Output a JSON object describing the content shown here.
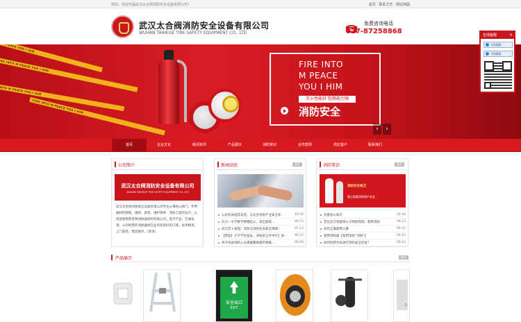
{
  "topbar": {
    "welcome": "您好，欢迎光临武汉太合阀消防安全设备有限公司！",
    "links": [
      "首页",
      "联系方式",
      "网站地图"
    ]
  },
  "header": {
    "company_cn": "武汉太合阀消防安全设备有限公司",
    "company_en": "WUHAN TAIHEGE TIRE SAFETY EQUIPMENT CO., LTD",
    "hotline_label": "免费咨询电话",
    "hotline_number": "027-87258868"
  },
  "banner": {
    "tape_text": "FIRE INTO M PEACE YOU I HIM",
    "promo_lines": [
      "FIRE INTO",
      "M PEACE",
      "YOU I HIM"
    ],
    "tagline": "灭火性能好  阻燃能力强",
    "slogan": "消防安全",
    "prev": "‹",
    "next": "›"
  },
  "nav": {
    "items": [
      "首页",
      "企业文化",
      "新闻资讯",
      "产品展示",
      "消防常识",
      "合作案例",
      "供应客户",
      "联系我们"
    ]
  },
  "about": {
    "title": "公司简介",
    "more": "更多",
    "banner_cn": "武汉太合阀消防安全设备有限公司",
    "banner_en": "WUHAN TAIHEGE TIRE SAFETY EQUIPMENT CO.,LTD",
    "text": "武汉太合阀消防安全设备有限公司专业从事防火阀门、专用器材的销售、维修、安装、维护保养、消防工程的设计，以及配套销售各种消防器材的有限公司。电子产品、交通设施、公司经营的消防器材在业内有良好的口碑，技术精湛，上门安装，售后服务。[更多]"
  },
  "news": {
    "title": "新闻动态",
    "more": "更多",
    "items": [
      {
        "t": "公诉机关就其谈话，与太合消防产业安全初...",
        "d": "10-20"
      },
      {
        "t": "武汉一大学教学楼楼起火，请全部疏...",
        "d": "09-23"
      },
      {
        "t": "武汉百十姐喵！消防汉消防生命安全保障！",
        "d": "07-13"
      },
      {
        "t": "【预案】大学学生宿舍，消防安全手中行】讲...",
        "d": "06-22"
      },
      {
        "t": "男子驾驶消防入员遇难警察遇到救援...",
        "d": "06-08"
      }
    ]
  },
  "knowledge": {
    "title": "消防常识",
    "more": "更多",
    "image_text_1": "消防安全保卫",
    "image_text_2": "细心照看消防财产安全",
    "items": [
      {
        "t": "热量防火知识",
        "d": "10-16"
      },
      {
        "t": "定位武汉地面将火灾预防措施：家用消防",
        "d": "09-23"
      },
      {
        "t": "如何正确使用火警",
        "d": "06-22"
      },
      {
        "t": "家用消防器【家用消防“消防”】",
        "d": "06-12"
      },
      {
        "t": "如何经营手段进行消防安全检查？",
        "d": "06-03"
      }
    ]
  },
  "products": {
    "title": "产品展示",
    "more": "更多",
    "exit_sign_text": "安全出口",
    "exit_sign_en": "EXIT",
    "prev": "‹",
    "next": "›"
  },
  "float": {
    "title": "在线客服",
    "close": "×",
    "qq_labels": [
      "QQ客服",
      "QQ客服"
    ]
  },
  "colors": {
    "brand_red": "#d8191f",
    "hotline_red": "#d8141b",
    "tape_yellow": "#f1b21b"
  }
}
